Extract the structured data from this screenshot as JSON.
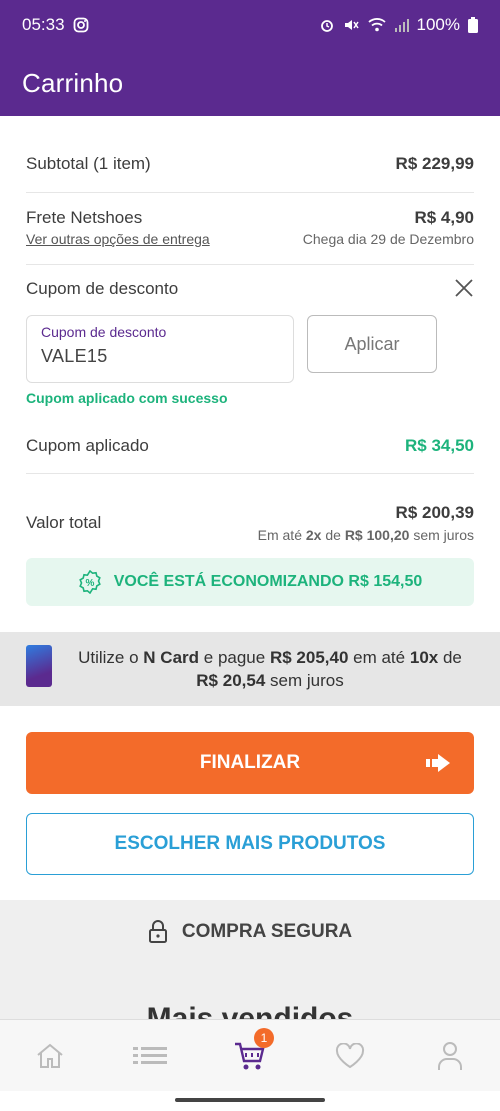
{
  "status_bar": {
    "time": "05:33",
    "battery": "100%"
  },
  "header": {
    "title": "Carrinho"
  },
  "summary": {
    "subtotal_label": "Subtotal (1 item)",
    "subtotal_value": "R$ 229,99",
    "shipping_label": "Frete Netshoes",
    "shipping_value": "R$ 4,90",
    "shipping_link": "Ver outras opções de entrega",
    "delivery_date": "Chega dia 29 de Dezembro"
  },
  "coupon": {
    "section_label": "Cupom de desconto",
    "input_label": "Cupom de desconto",
    "input_value": "VALE15",
    "apply_label": "Aplicar",
    "success_message": "Cupom aplicado com sucesso",
    "applied_label": "Cupom aplicado",
    "applied_value": "R$ 34,50"
  },
  "total": {
    "label": "Valor total",
    "value": "R$ 200,39",
    "installments_prefix": "Em até",
    "installments_count": "2x",
    "installments_mid": "de",
    "installments_value": "R$ 100,20",
    "installments_suffix": "sem juros"
  },
  "savings": {
    "text": "VOCÊ ESTÁ ECONOMIZANDO R$ 154,50"
  },
  "ncard": {
    "t1": "Utilize o",
    "t2": "N Card",
    "t3": "e pague",
    "t4": "R$ 205,40",
    "t5": "em até",
    "t6": "10x",
    "t7": "de",
    "t8": "R$ 20,54",
    "t9": "sem juros"
  },
  "actions": {
    "finalize": "FINALIZAR",
    "more_products": "ESCOLHER MAIS PRODUTOS"
  },
  "secure": {
    "label": "COMPRA SEGURA",
    "teaser": "Mais vendidos"
  },
  "nav": {
    "cart_badge": "1"
  },
  "colors": {
    "primary": "#5b2a8f",
    "accent": "#f36b2a",
    "success": "#1db37c",
    "link_blue": "#2a9fd6"
  }
}
